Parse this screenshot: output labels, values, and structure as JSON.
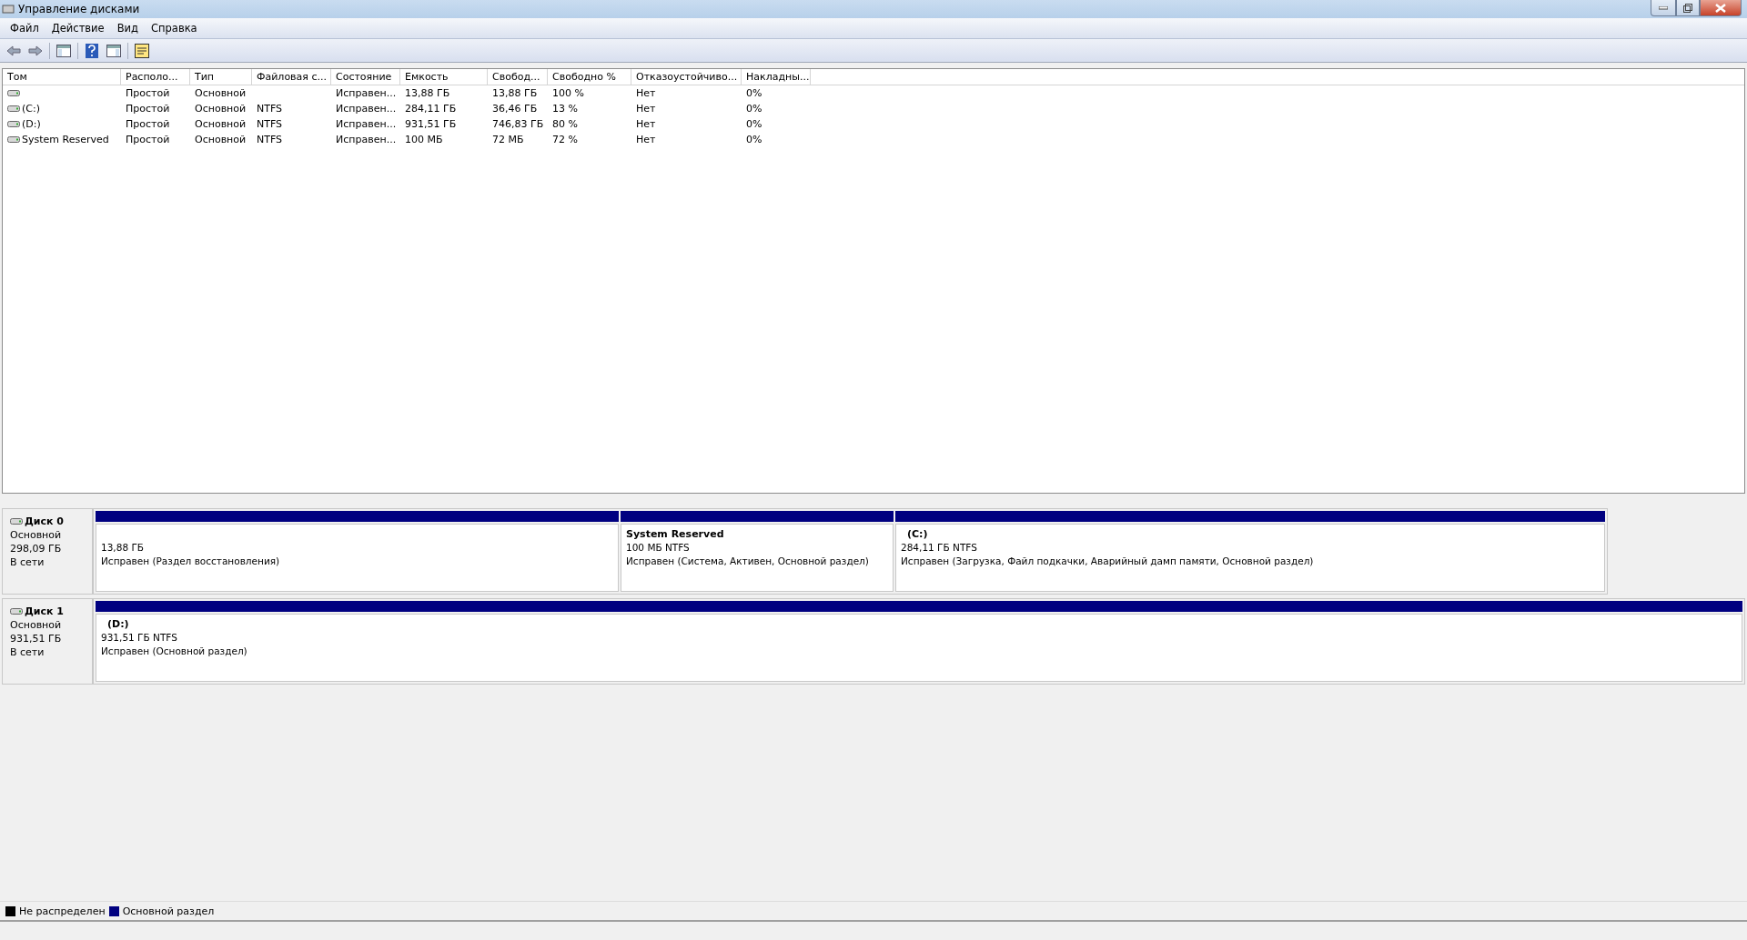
{
  "window": {
    "title": "Управление дисками"
  },
  "menu": [
    "Файл",
    "Действие",
    "Вид",
    "Справка"
  ],
  "table": {
    "columns": [
      "Том",
      "Располо...",
      "Тип",
      "Файловая с...",
      "Состояние",
      "Емкость",
      "Свобод...",
      "Свободно %",
      "Отказоустойчиво...",
      "Накладны..."
    ],
    "rows": [
      {
        "cells": [
          "",
          "Простой",
          "Основной",
          "",
          "Исправен...",
          "13,88 ГБ",
          "13,88 ГБ",
          "100 %",
          "Нет",
          "0%"
        ]
      },
      {
        "cells": [
          "(C:)",
          "Простой",
          "Основной",
          "NTFS",
          "Исправен...",
          "284,11 ГБ",
          "36,46 ГБ",
          "13 %",
          "Нет",
          "0%"
        ]
      },
      {
        "cells": [
          "(D:)",
          "Простой",
          "Основной",
          "NTFS",
          "Исправен...",
          "931,51 ГБ",
          "746,83 ГБ",
          "80 %",
          "Нет",
          "0%"
        ]
      },
      {
        "cells": [
          "System Reserved",
          "Простой",
          "Основной",
          "NTFS",
          "Исправен...",
          "100 МБ",
          "72 МБ",
          "72 %",
          "Нет",
          "0%"
        ]
      }
    ]
  },
  "disks": [
    {
      "name": "Диск 0",
      "type": "Основной",
      "size": "298,09 ГБ",
      "status": "В сети",
      "partitions": [
        {
          "size": "13,88 ГБ",
          "status": "Исправен (Раздел восстановления)"
        },
        {
          "name": "System Reserved",
          "size": "100 МБ NTFS",
          "status": "Исправен (Система, Активен, Основной раздел)"
        },
        {
          "name": "(C:)",
          "size": "284,11 ГБ NTFS",
          "status": "Исправен (Загрузка, Файл подкачки, Аварийный дамп памяти, Основной раздел)"
        }
      ]
    },
    {
      "name": "Диск 1",
      "type": "Основной",
      "size": "931,51 ГБ",
      "status": "В сети",
      "partitions": [
        {
          "name": "(D:)",
          "size": "931,51 ГБ NTFS",
          "status": "Исправен (Основной раздел)"
        }
      ]
    }
  ],
  "legend": [
    {
      "label": "Не распределен",
      "color": "#000000"
    },
    {
      "label": "Основной раздел",
      "color": "#000080"
    }
  ]
}
